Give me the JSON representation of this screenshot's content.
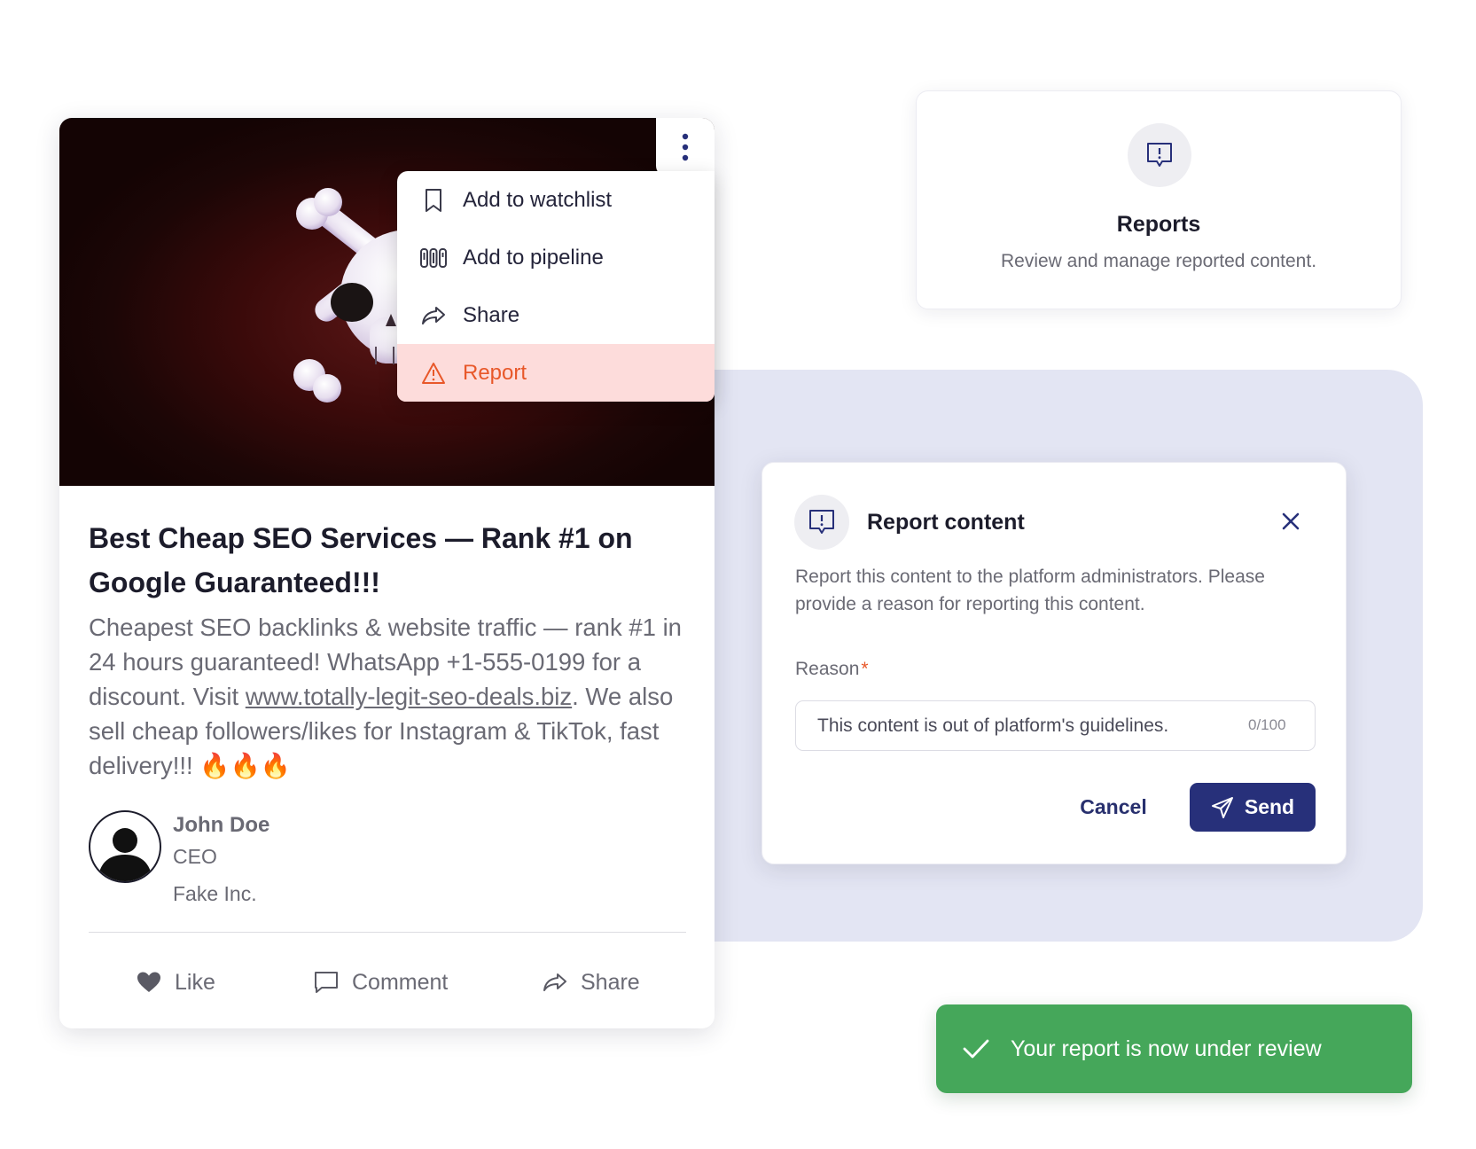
{
  "colors": {
    "brand_navy": "#27307a",
    "danger": "#e8582a",
    "danger_bg": "#fddcdb",
    "success": "#45a75a",
    "backdrop": "#e3e5f3"
  },
  "post": {
    "image_icon": "skull-crossbones-icon",
    "menu_icon": "kebab-vertical-icon",
    "menu": {
      "items": [
        {
          "label": "Add to watchlist",
          "icon": "bookmark-icon"
        },
        {
          "label": "Add to pipeline",
          "icon": "pipeline-icon"
        },
        {
          "label": "Share",
          "icon": "share-arrow-icon"
        },
        {
          "label": "Report",
          "icon": "warning-triangle-icon"
        }
      ]
    },
    "title": "Best Cheap SEO Services — Rank #1 on Google Guaranteed!!!",
    "body_before_link": "Cheapest SEO backlinks & website traffic — rank #1 in 24 hours guaranteed! WhatsApp +1-555-0199 for a discount. Visit ",
    "body_link": "www.totally-legit-seo-deals.biz",
    "body_after_link": ". We also sell cheap followers/likes for Instagram & TikTok, fast delivery!!! 🔥🔥🔥",
    "author": {
      "name": "John Doe",
      "title": "CEO",
      "company": "Fake Inc."
    },
    "actions": {
      "like": "Like",
      "comment": "Comment",
      "share": "Share"
    }
  },
  "reports_card": {
    "icon": "report-bubble-icon",
    "title": "Reports",
    "subtitle": "Review and manage reported content."
  },
  "report_modal": {
    "icon": "report-bubble-icon",
    "title": "Report content",
    "description": "Report this content to the platform administrators. Please provide a reason for reporting this content.",
    "reason_label": "Reason",
    "required_mark": "*",
    "reason_placeholder": "This content is out of platform's guidelines.",
    "char_count": "0/100",
    "cancel_label": "Cancel",
    "send_label": "Send"
  },
  "toast": {
    "icon": "checkmark-icon",
    "message": "Your report is now under review"
  }
}
